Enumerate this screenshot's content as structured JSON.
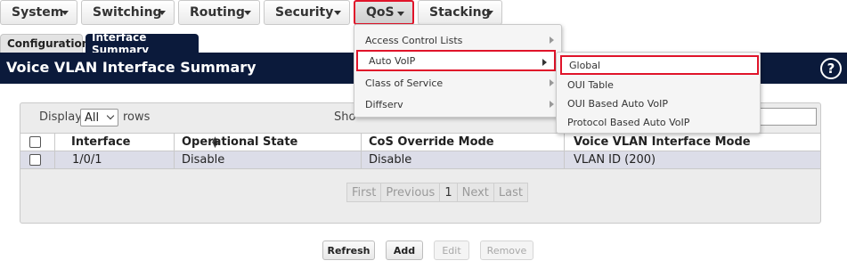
{
  "nav": {
    "items": [
      {
        "label": "System"
      },
      {
        "label": "Switching"
      },
      {
        "label": "Routing"
      },
      {
        "label": "Security"
      },
      {
        "label": "QoS"
      },
      {
        "label": "Stacking"
      }
    ]
  },
  "tabs": [
    {
      "label": "Configuration"
    },
    {
      "label": "Interface Summary"
    }
  ],
  "page": {
    "title": "Voice VLAN Interface Summary",
    "help_symbol": "?"
  },
  "table_controls": {
    "display_label": "Display",
    "display_value": "All",
    "rows_label": "rows",
    "show_label": "Sho"
  },
  "table": {
    "columns": [
      "Interface",
      "Operational State",
      "CoS Override Mode",
      "Voice VLAN Interface Mode"
    ],
    "rows": [
      {
        "interface": "1/0/1",
        "operational_state": "Disable",
        "cos_override_mode": "Disable",
        "voice_vlan_mode": "VLAN ID (200)"
      }
    ]
  },
  "pager": {
    "first": "First",
    "previous": "Previous",
    "current": "1",
    "next": "Next",
    "last": "Last"
  },
  "buttons": {
    "refresh": "Refresh",
    "add": "Add",
    "edit": "Edit",
    "remove": "Remove"
  },
  "qos_menu": {
    "items": [
      {
        "label": "Access Control Lists"
      },
      {
        "label": "Auto VoIP"
      },
      {
        "label": "Class of Service"
      },
      {
        "label": "Diffserv"
      }
    ]
  },
  "autovoip_submenu": {
    "items": [
      {
        "label": "Global"
      },
      {
        "label": "OUI Table"
      },
      {
        "label": "OUI Based Auto VoIP"
      },
      {
        "label": "Protocol Based Auto VoIP"
      }
    ]
  },
  "colors": {
    "header_background": "#0b1a3b",
    "highlight_border": "#e0142a",
    "selected_row": "#dcdde8"
  }
}
